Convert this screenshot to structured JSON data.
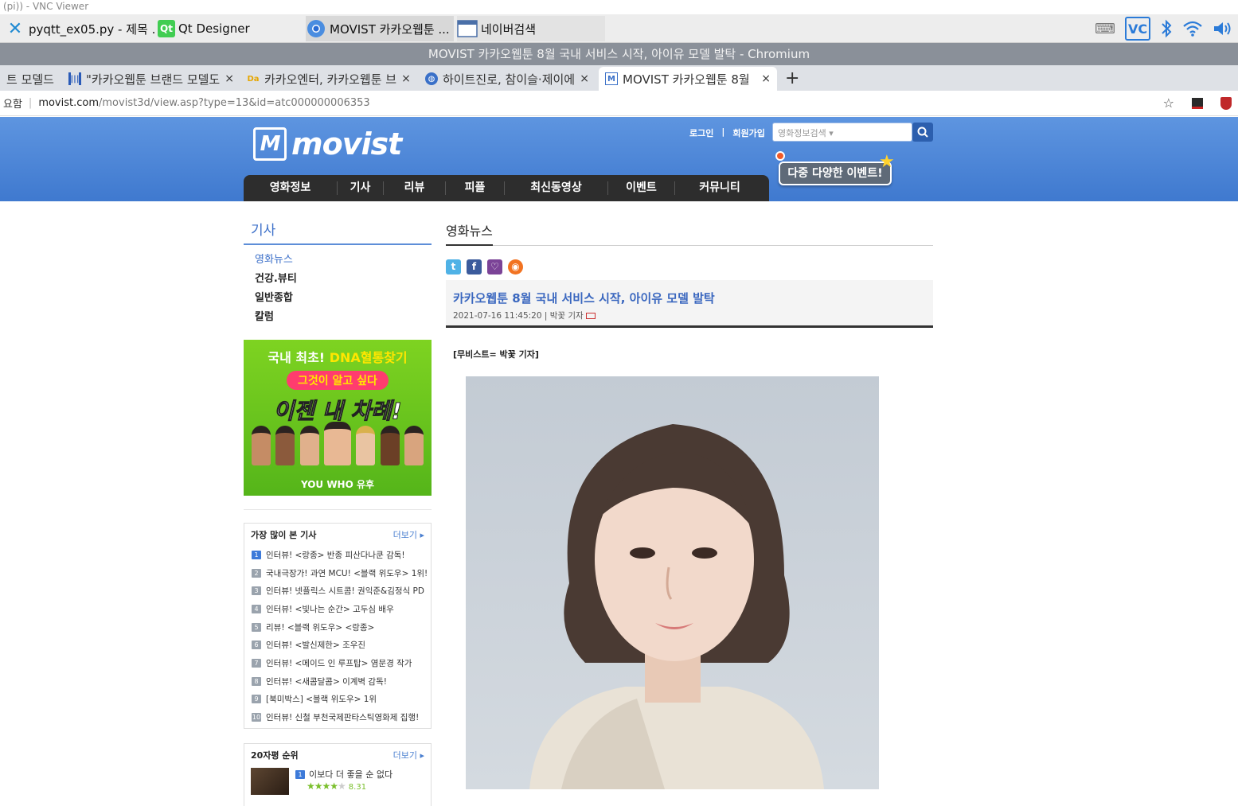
{
  "vnc": {
    "title": "(pi)) - VNC Viewer"
  },
  "taskbar": {
    "tasks": [
      {
        "label": "pyqtt_ex05.py - 제목 ..."
      },
      {
        "label": "Qt Designer"
      },
      {
        "label": "MOVIST 카카오웹툰 ..."
      },
      {
        "label": "네이버검색"
      }
    ],
    "tray_icons": [
      "keyboard-icon",
      "vnc-icon",
      "bluetooth-icon",
      "wifi-icon",
      "volume-icon"
    ]
  },
  "browser": {
    "window_title": "MOVIST 카카오웹툰 8월 국내 서비스 시작, 아이유 모델 발탁 - Chromium",
    "tabs": [
      {
        "label": "트 모델드"
      },
      {
        "label": "\"카카오웹툰 브랜드 모델도"
      },
      {
        "label": "카카오엔터, 카카오웹툰 브"
      },
      {
        "label": "하이트진로, 참이슬·제이에"
      },
      {
        "label": "MOVIST 카카오웹툰 8월"
      }
    ],
    "new_tab": "+",
    "tab_close": "×",
    "address": {
      "site_label": "요함",
      "host": "movist.com",
      "path": "/movist3d/view.asp?type=13&id=atc000000006353"
    }
  },
  "site": {
    "logo": "movist",
    "top_links": {
      "login": "로그인",
      "join": "회원가입",
      "divider": "|"
    },
    "search": {
      "placeholder": "영화정보검색 ▾"
    },
    "event_badge": "다중 다양한 이벤트!",
    "nav": [
      "영화정보",
      "기사",
      "리뷰",
      "피플",
      "최신동영상",
      "이벤트",
      "커뮤니티"
    ]
  },
  "sidebar": {
    "title": "기사",
    "items": [
      {
        "label": "영화뉴스"
      },
      {
        "label": "건강.뷰티"
      },
      {
        "label": "일반종합"
      },
      {
        "label": "칼럼"
      }
    ],
    "ad": {
      "line1_prefix": "국내 최초!",
      "line1_emph": "DNA혈통찾기",
      "line2": "그것이 알고 싶다",
      "line3": "이젠 내 차례!",
      "brand": "YOU WHO 유후"
    },
    "most_viewed": {
      "title": "가장 많이 본 기사",
      "more": "더보기 ▸",
      "items": [
        "인터뷰! <랑종> 반종 피산다나쿤 감독!",
        "국내극장가! 과연 MCU! <블랙 위도우> 1위!",
        "인터뷰! 넷플릭스 시트콤! 권익준&김정식 PD",
        "인터뷰! <빛나는 순간> 고두심 배우",
        "리뷰! <블랙 위도우> <랑종>",
        "인터뷰! <발신제한> 조우진",
        "인터뷰! <메이드 인 루프탑> 염문경 작가",
        "인터뷰! <새콤달콤> 이계벽 감독!",
        "[북미박스] <블랙 위도우> 1위",
        "인터뷰! 신철 부천국제판타스틱영화제 집행!"
      ]
    },
    "rating": {
      "title": "20자평 순위",
      "more": "더보기 ▸",
      "items": [
        {
          "title": "이보다 더 좋을 순 없다",
          "score": "8.31"
        }
      ]
    }
  },
  "article": {
    "section": "영화뉴스",
    "title": "카카오웹툰 8월 국내 서비스 시작, 아이유 모델 발탁",
    "meta": "2021-07-16 11:45:20 | 박꽃 기자",
    "byline": "[무비스트= 박꽃 기자]"
  }
}
